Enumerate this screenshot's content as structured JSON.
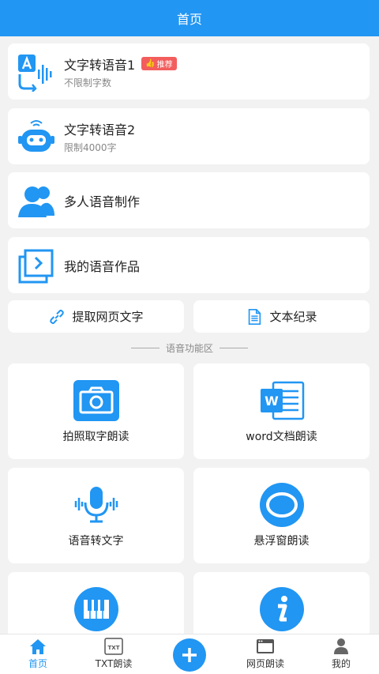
{
  "header": {
    "title": "首页"
  },
  "rows": [
    {
      "title": "文字转语音1",
      "badge": "推荐",
      "sub": "不限制字数"
    },
    {
      "title": "文字转语音2",
      "sub": "限制4000字"
    },
    {
      "title": "多人语音制作"
    },
    {
      "title": "我的语音作品"
    }
  ],
  "quick": {
    "extract": "提取网页文字",
    "records": "文本纪录"
  },
  "section": {
    "title": "语音功能区"
  },
  "tiles": [
    {
      "label": "拍照取字朗读"
    },
    {
      "label": "word文档朗读"
    },
    {
      "label": "语音转文字"
    },
    {
      "label": "悬浮窗朗读"
    },
    {
      "label": ""
    },
    {
      "label": ""
    }
  ],
  "tabbar": {
    "home": "首页",
    "txt": "TXT朗读",
    "web": "网页朗读",
    "mine": "我的",
    "txt_icon_text": "TXT"
  },
  "colors": {
    "accent": "#2196f3",
    "badge": "#f35d5d"
  }
}
